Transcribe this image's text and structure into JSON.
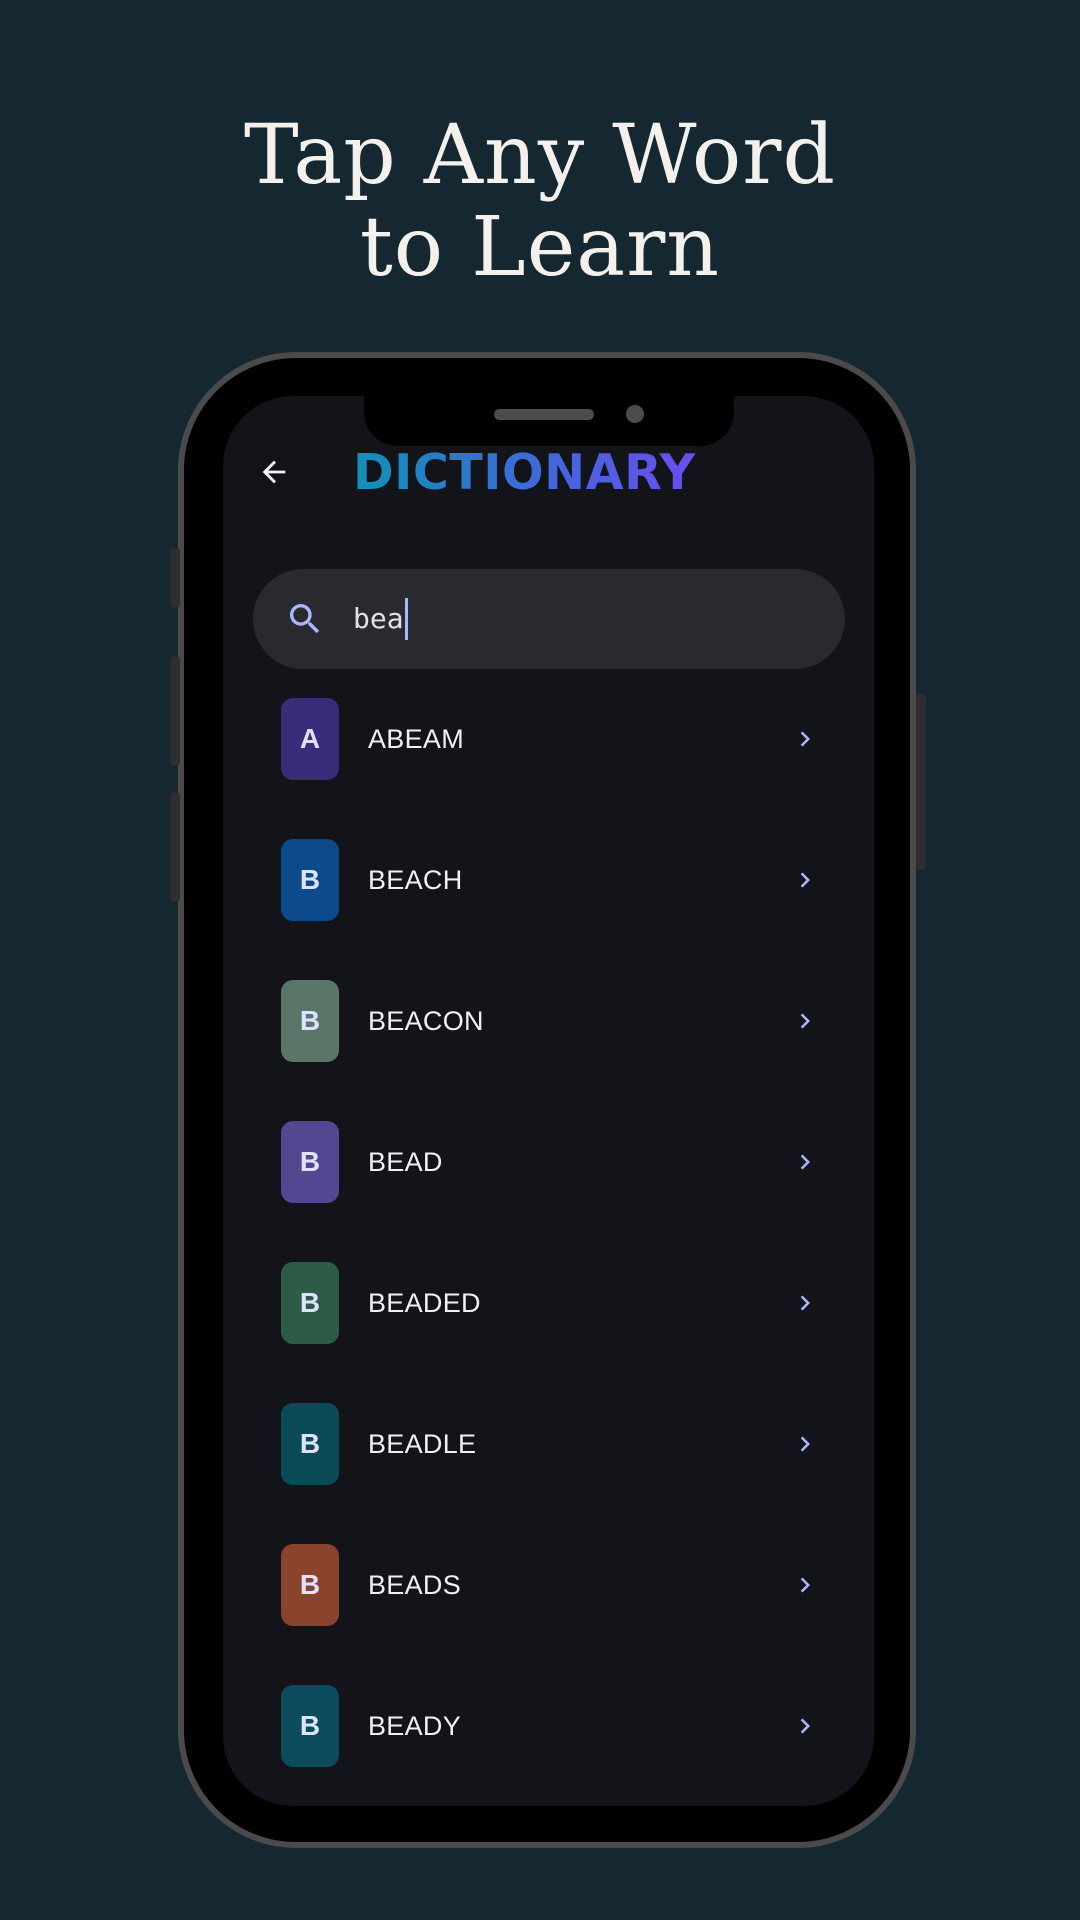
{
  "promo": {
    "headline_line1": "Tap Any Word",
    "headline_line2": "to Learn"
  },
  "app": {
    "title": "DICTIONARY",
    "back_icon": "arrow-left-icon"
  },
  "search": {
    "icon": "search-icon",
    "value": "bea"
  },
  "words": [
    {
      "letter": "A",
      "word": "ABEAM",
      "tile_color": "#3b2c7a"
    },
    {
      "letter": "B",
      "word": "BEACH",
      "tile_color": "#0c4a8c"
    },
    {
      "letter": "B",
      "word": "BEACON",
      "tile_color": "#5b7569"
    },
    {
      "letter": "B",
      "word": "BEAD",
      "tile_color": "#544690"
    },
    {
      "letter": "B",
      "word": "BEADED",
      "tile_color": "#2e5a48"
    },
    {
      "letter": "B",
      "word": "BEADLE",
      "tile_color": "#0b4b58"
    },
    {
      "letter": "B",
      "word": "BEADS",
      "tile_color": "#8a432c"
    },
    {
      "letter": "B",
      "word": "BEADY",
      "tile_color": "#0b4b5c"
    }
  ],
  "colors": {
    "page_background": "#152730",
    "screen_background": "#13141a",
    "search_background": "#29292f",
    "accent_icon": "#a8b8ff",
    "title_gradient_start": "#1191b6",
    "title_gradient_end": "#6a4df0"
  }
}
